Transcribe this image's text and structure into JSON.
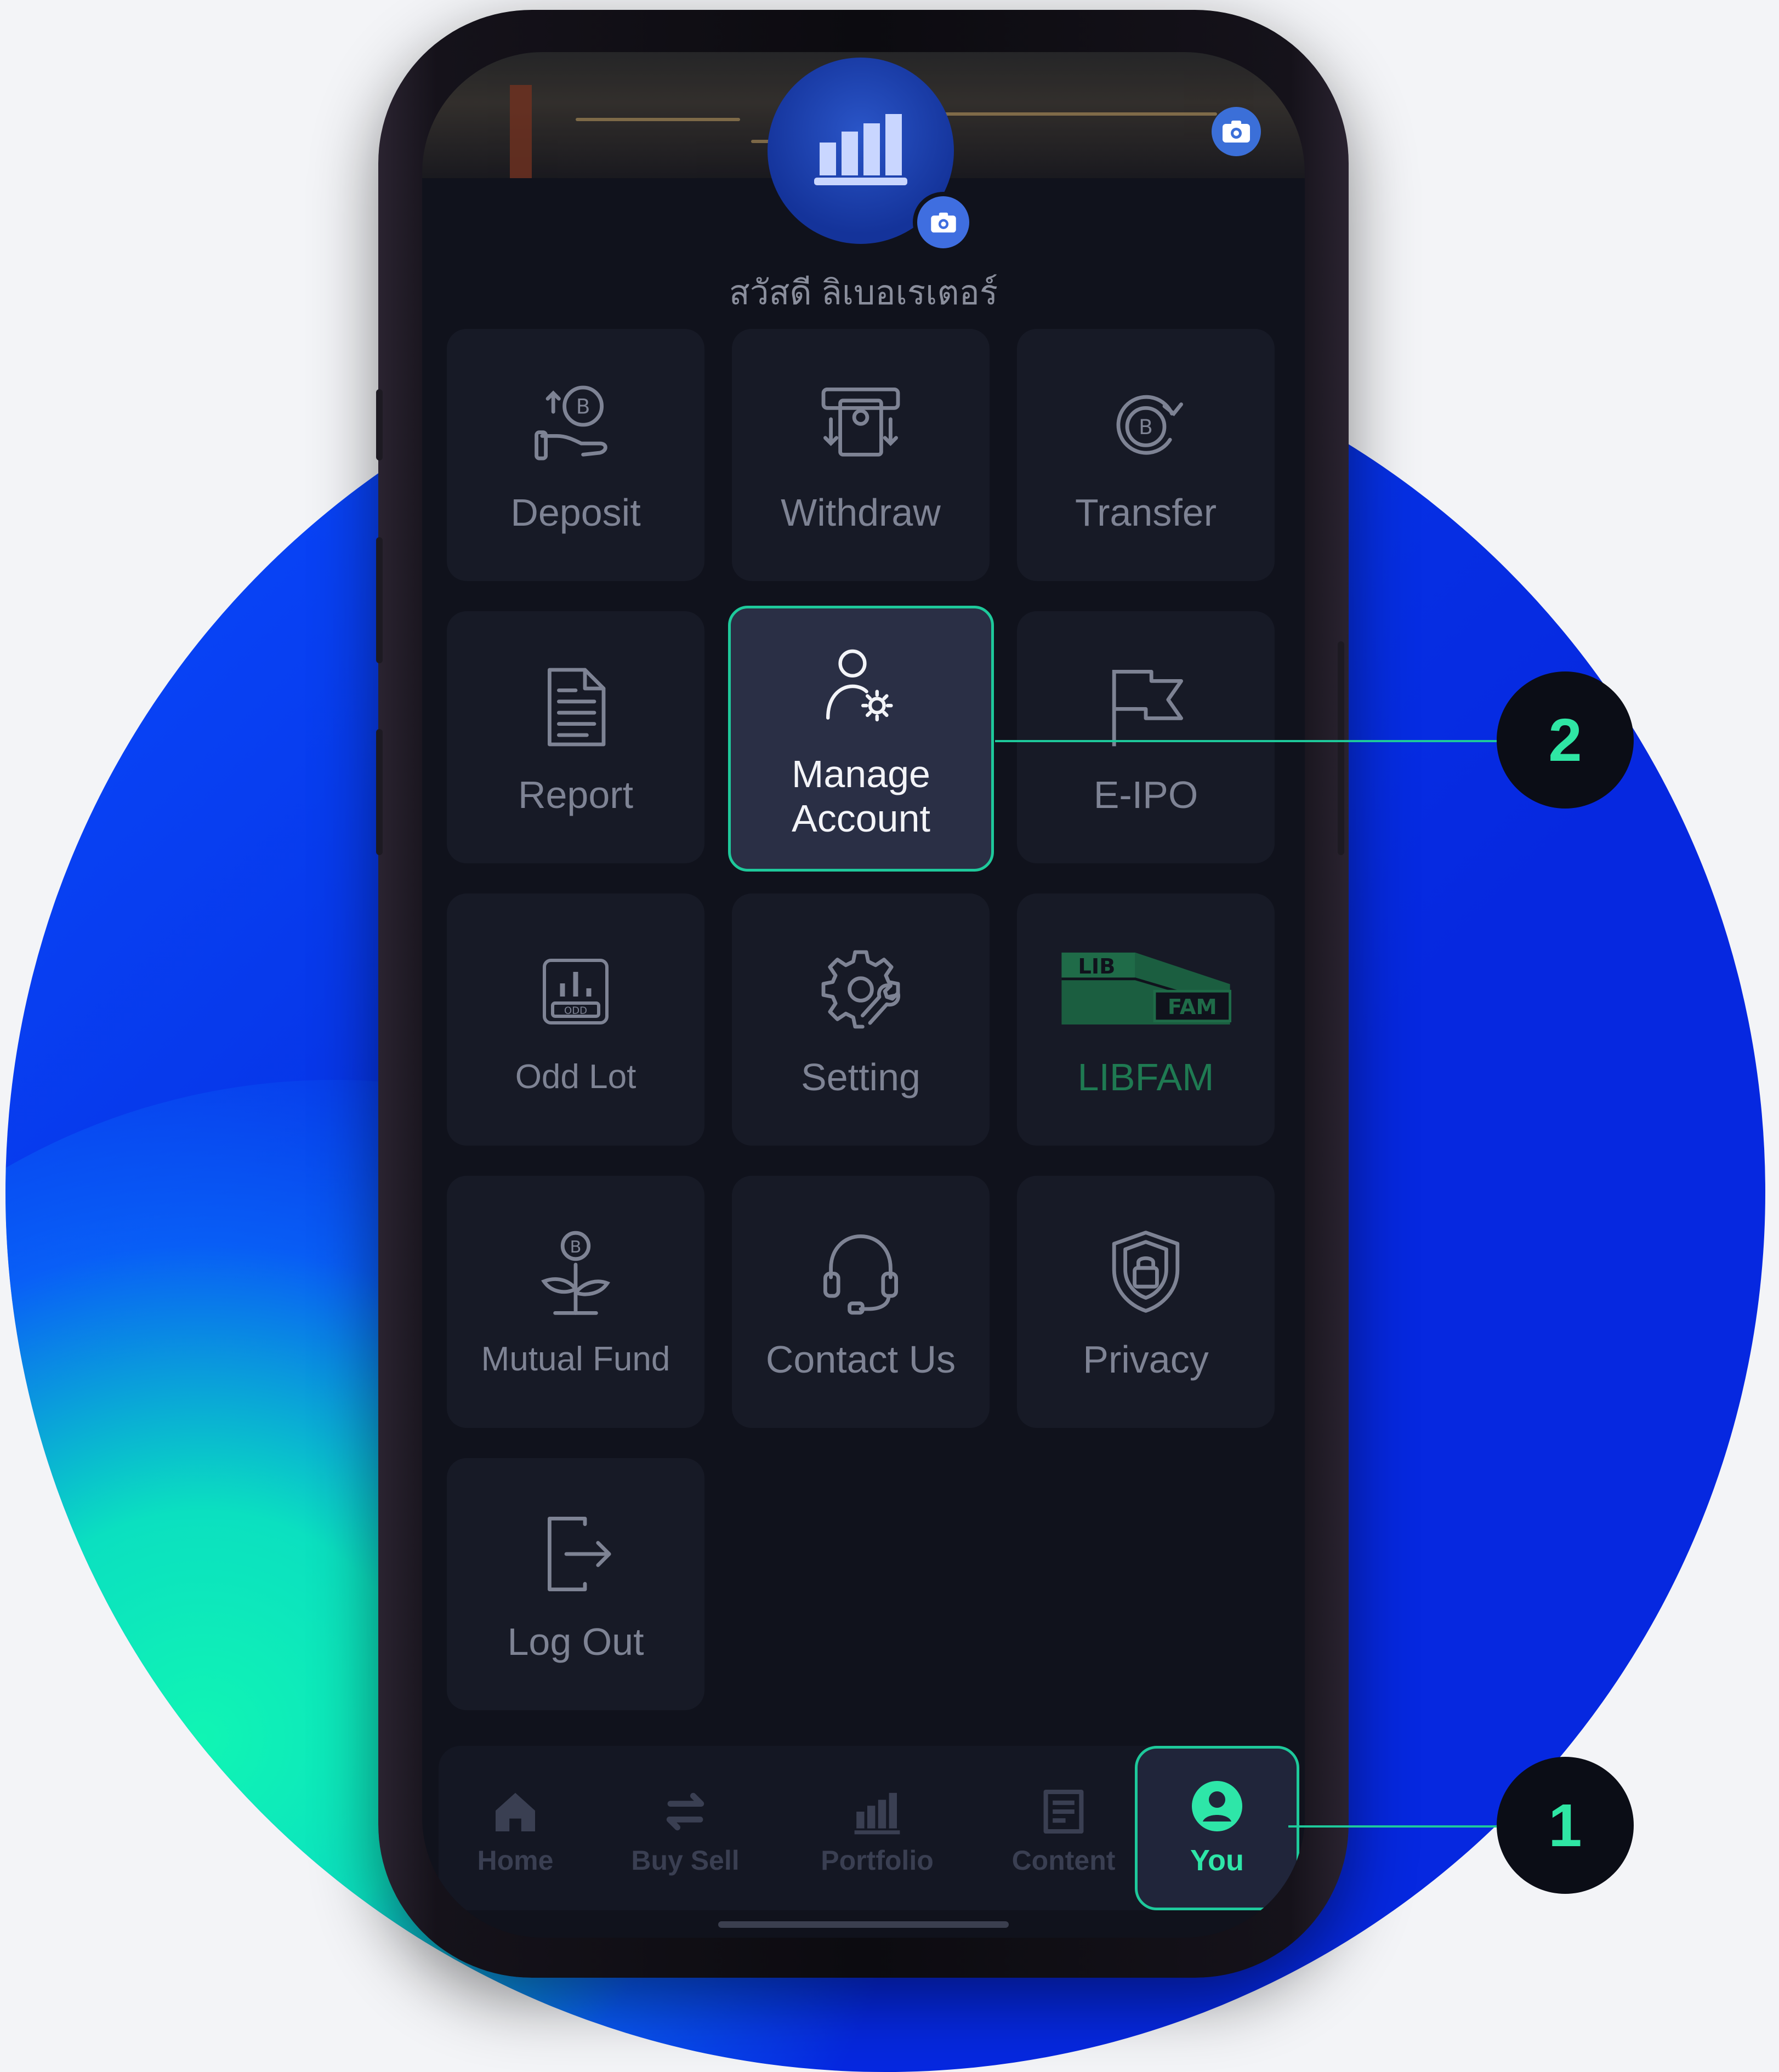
{
  "profile": {
    "greeting": "สวัสดี ลิเบอเรเตอร์"
  },
  "menu": [
    {
      "label": "Deposit",
      "icon": "baht-deposit-icon"
    },
    {
      "label": "Withdraw",
      "icon": "atm-withdraw-icon"
    },
    {
      "label": "Transfer",
      "icon": "baht-transfer-icon"
    },
    {
      "label": "Report",
      "icon": "document-icon"
    },
    {
      "label": "Manage Account",
      "icon": "user-gear-icon"
    },
    {
      "label": "E-IPO",
      "icon": "flag-icon"
    },
    {
      "label": "Odd Lot",
      "icon": "odd-lot-icon",
      "badge": "ODD"
    },
    {
      "label": "Setting",
      "icon": "gear-wrench-icon"
    },
    {
      "label": "LIBFAM",
      "icon": "libfam-logo",
      "logo_top": "LIB",
      "logo_bottom": "FAM"
    },
    {
      "label": "Mutual Fund",
      "icon": "baht-plant-icon"
    },
    {
      "label": "Contact Us",
      "icon": "headset-icon"
    },
    {
      "label": "Privacy",
      "icon": "shield-lock-icon"
    },
    {
      "label": "Log Out",
      "icon": "logout-icon"
    }
  ],
  "nav": {
    "home": "Home",
    "buysell": "Buy Sell",
    "portfolio": "Portfolio",
    "content": "Content",
    "you": "You"
  },
  "callouts": {
    "one": "1",
    "two": "2"
  },
  "colors": {
    "accent": "#1ec99b",
    "callout_text": "#2fe6a4",
    "screen_bg": "#10121c"
  }
}
